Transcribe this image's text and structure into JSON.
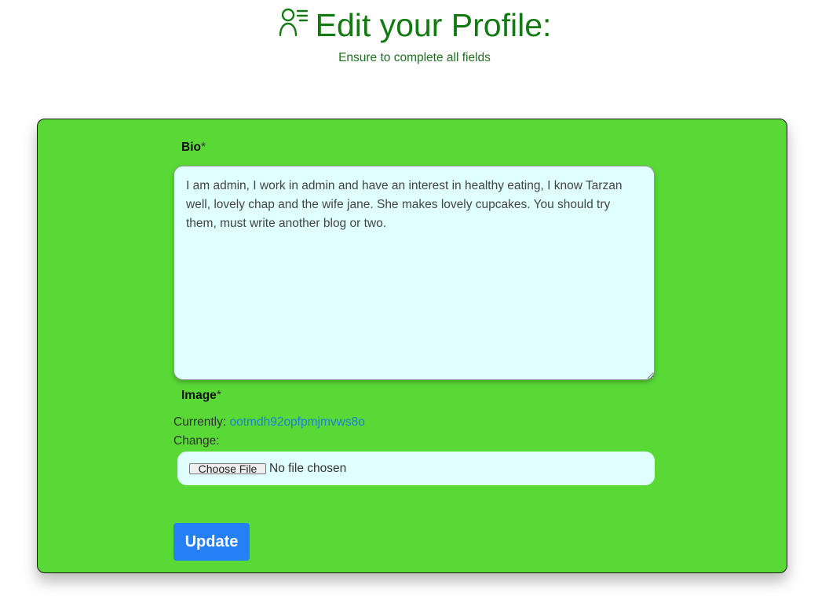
{
  "header": {
    "icon": "user-list-icon",
    "title": "Edit your Profile:",
    "subtitle": "Ensure to complete all fields"
  },
  "form": {
    "bio": {
      "label": "Bio",
      "required_marker": "*",
      "value": "I am admin, I work in admin and have an interest in healthy eating, I know Tarzan well, lovely chap and the wife jane. She makes lovely cupcakes. You should try them, must write another blog or two."
    },
    "image": {
      "label": "Image",
      "required_marker": "*",
      "currently_label": "Currently:",
      "current_file": "ootmdh92opfpmjmvws8o",
      "change_label": "Change:",
      "choose_button": "Choose File",
      "file_status": "No file chosen"
    },
    "submit_label": "Update"
  },
  "colors": {
    "title_green": "#137a13",
    "card_background": "#58d936",
    "input_background": "#e0ffff",
    "button_blue": "#2680f5",
    "link_blue": "#1f7fd6"
  }
}
